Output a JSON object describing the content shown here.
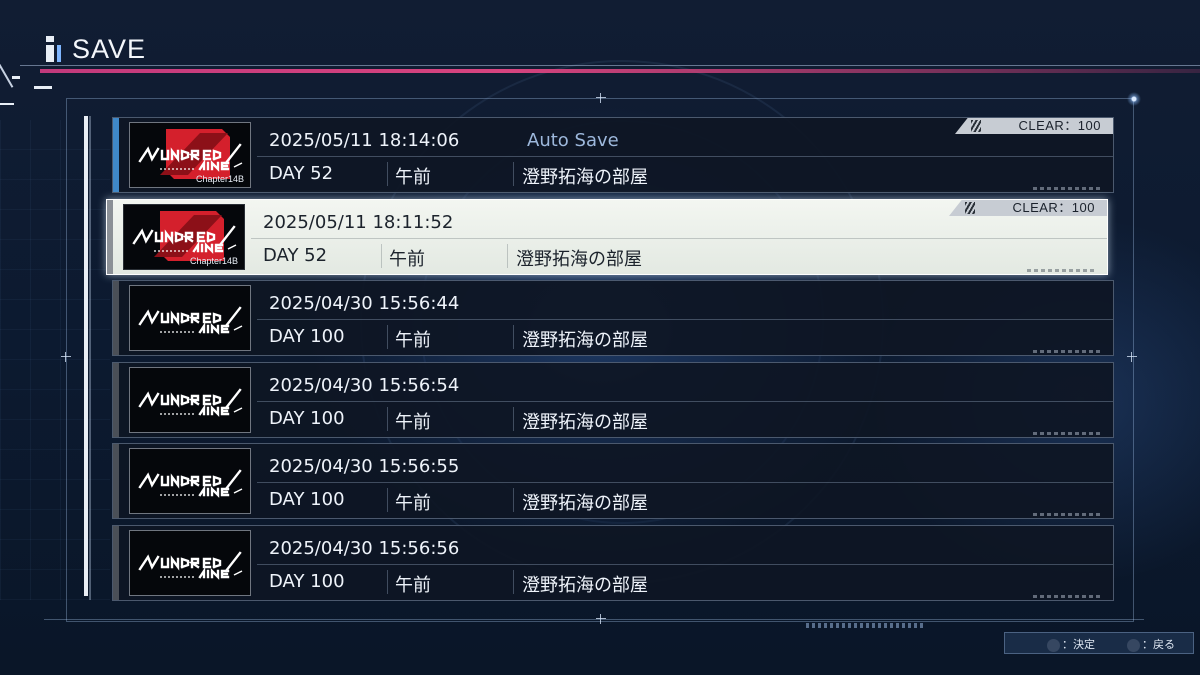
{
  "header": {
    "title": "SAVE"
  },
  "saves": [
    {
      "date": "2025/05/11 18:14:06",
      "auto_label": "Auto Save",
      "day": "DAY 52",
      "time_of_day": "午前",
      "location": "澄野拓海の部屋",
      "clear": "CLEAR：100",
      "thumb_chapter": "Chapter14B",
      "thumb_logo": "HUNDRED LINE",
      "thumb_style": "chapter"
    },
    {
      "date": "2025/05/11 18:11:52",
      "auto_label": "",
      "day": "DAY 52",
      "time_of_day": "午前",
      "location": "澄野拓海の部屋",
      "clear": "CLEAR：100",
      "thumb_chapter": "Chapter14B",
      "thumb_logo": "HUNDRED LINE",
      "thumb_style": "chapter"
    },
    {
      "date": "2025/04/30 15:56:44",
      "auto_label": "",
      "day": "DAY 100",
      "time_of_day": "午前",
      "location": "澄野拓海の部屋",
      "clear": "",
      "thumb_chapter": "",
      "thumb_logo": "HUNDRED LINE",
      "thumb_style": "plain"
    },
    {
      "date": "2025/04/30 15:56:54",
      "auto_label": "",
      "day": "DAY 100",
      "time_of_day": "午前",
      "location": "澄野拓海の部屋",
      "clear": "",
      "thumb_chapter": "",
      "thumb_logo": "HUNDRED LINE",
      "thumb_style": "plain"
    },
    {
      "date": "2025/04/30 15:56:55",
      "auto_label": "",
      "day": "DAY 100",
      "time_of_day": "午前",
      "location": "澄野拓海の部屋",
      "clear": "",
      "thumb_chapter": "",
      "thumb_logo": "HUNDRED LINE",
      "thumb_style": "plain"
    },
    {
      "date": "2025/04/30 15:56:56",
      "auto_label": "",
      "day": "DAY 100",
      "time_of_day": "午前",
      "location": "澄野拓海の部屋",
      "clear": "",
      "thumb_chapter": "",
      "thumb_logo": "HUNDRED LINE",
      "thumb_style": "plain"
    }
  ],
  "selected_index": 1,
  "footer": {
    "confirm_label": "：決定",
    "back_label": "：戻る"
  },
  "colors": {
    "accent_pink": "#d7447f",
    "auto_accent": "#3f88c8",
    "autosave_text": "#9db8dc",
    "thumb_red": "#d4202c"
  }
}
